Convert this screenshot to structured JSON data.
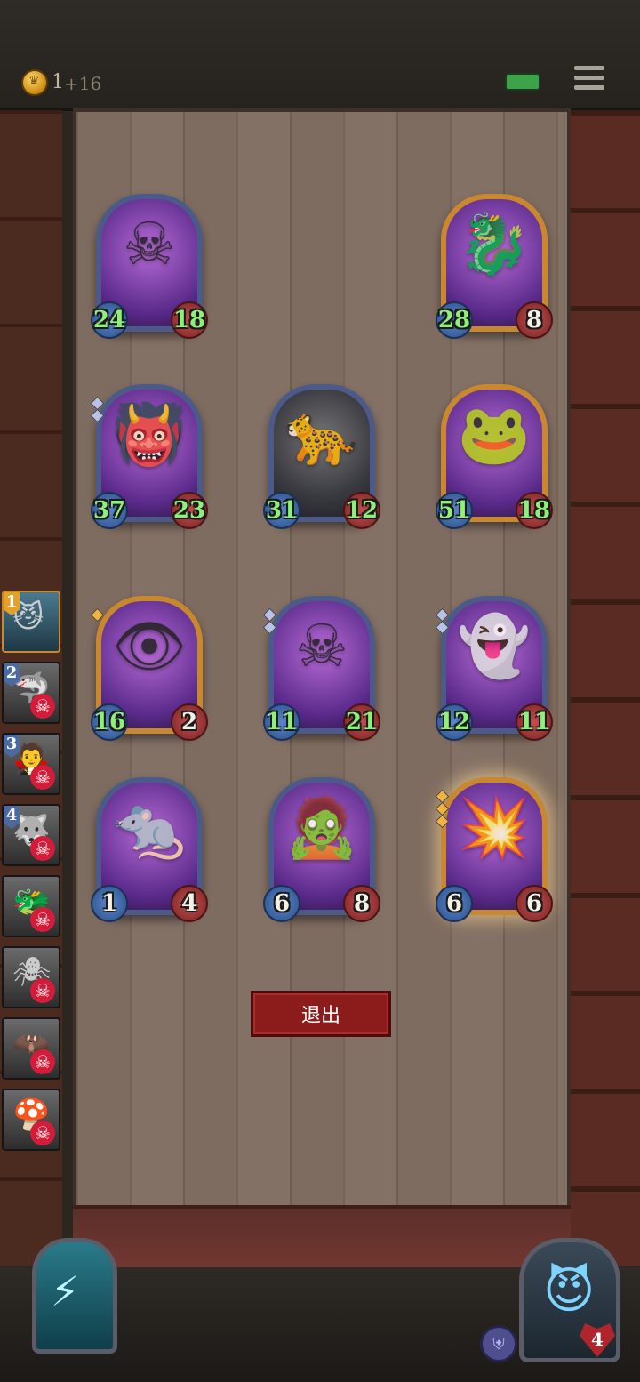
{
  "top_bar": {
    "gold_count": "1",
    "gold_income": "+16",
    "icons": [
      "crown-coin-icon",
      "battery-icon",
      "menu-icon"
    ]
  },
  "board": {
    "cards": [
      {
        "id": "lich",
        "portrait": "skull-necromancer",
        "glyph": "☠",
        "attack": "24",
        "health": "18",
        "frame": "silver",
        "tier": 0
      },
      {
        "id": "purple-dragon",
        "portrait": "purple-dragon",
        "glyph": "🐉",
        "attack": "28",
        "health": "8",
        "frame": "gold",
        "tier": 0
      },
      {
        "id": "fire-demon",
        "portrait": "fire-demon",
        "glyph": "👹",
        "attack": "37",
        "health": "23",
        "frame": "silver",
        "tier": 2
      },
      {
        "id": "black-panther",
        "portrait": "black-panther",
        "glyph": "🐆",
        "attack": "31",
        "health": "12",
        "frame": "silver",
        "tier": 0
      },
      {
        "id": "green-frog-dragon",
        "portrait": "frog-dragon",
        "glyph": "🐸",
        "attack": "51",
        "health": "18",
        "frame": "gold",
        "tier": 0
      },
      {
        "id": "ghoul-child",
        "portrait": "ghoul",
        "glyph": "👁",
        "attack": "16",
        "health": "2",
        "frame": "gold",
        "tier": 1
      },
      {
        "id": "reaper",
        "portrait": "reaper",
        "glyph": "☠",
        "attack": "11",
        "health": "21",
        "frame": "silver",
        "tier": 2
      },
      {
        "id": "ghost-ogre",
        "portrait": "ghost-ogre",
        "glyph": "👻",
        "attack": "12",
        "health": "11",
        "frame": "silver",
        "tier": 2
      },
      {
        "id": "rat-thug",
        "portrait": "rat",
        "glyph": "🐀",
        "attack": "1",
        "health": "4",
        "frame": "silver",
        "tier": 0
      },
      {
        "id": "scarecrow",
        "portrait": "scarecrow",
        "glyph": "🧟",
        "attack": "6",
        "health": "8",
        "frame": "silver",
        "tier": 0
      },
      {
        "id": "cannon",
        "portrait": "cannon",
        "glyph": "💥",
        "attack": "6",
        "health": "6",
        "frame": "gold",
        "tier": 3
      }
    ]
  },
  "exit_button": {
    "label": "退出"
  },
  "opponents": [
    {
      "rank": "1",
      "face": "😼",
      "eliminated": false,
      "current": true
    },
    {
      "rank": "2",
      "face": "🦈",
      "eliminated": true
    },
    {
      "rank": "3",
      "face": "🧛",
      "eliminated": true
    },
    {
      "rank": "4",
      "face": "🐺",
      "eliminated": true
    },
    {
      "rank": "",
      "face": "🐲",
      "eliminated": true
    },
    {
      "rank": "",
      "face": "🕷",
      "eliminated": true
    },
    {
      "rank": "",
      "face": "🦇",
      "eliminated": true
    },
    {
      "rank": "",
      "face": "🍄",
      "eliminated": true
    }
  ],
  "hero": {
    "health": "4",
    "armor_icon": "shield-icon",
    "portrait": "blue-imp",
    "power_icon": "lightning-icon"
  }
}
